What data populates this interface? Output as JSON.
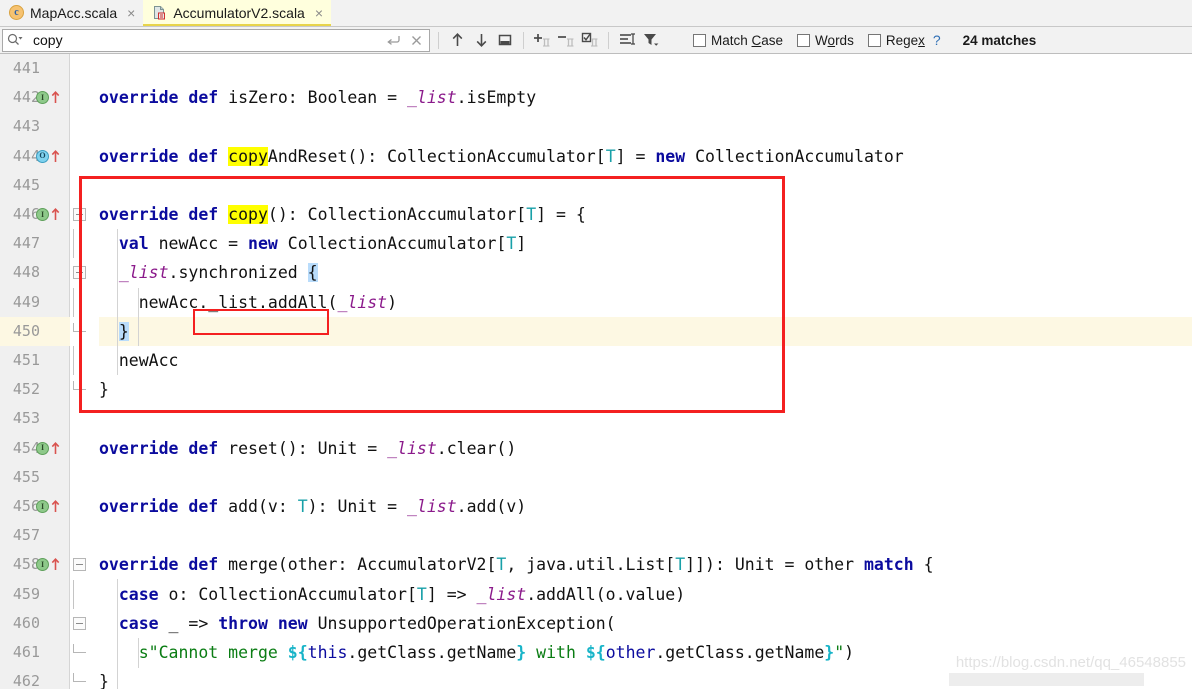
{
  "tabs": [
    {
      "label": "MapAcc.scala",
      "icon": "scala-class-icon",
      "close": "×",
      "active": false
    },
    {
      "label": "AccumulatorV2.scala",
      "icon": "scala-object-icon",
      "close": "×",
      "active": true
    }
  ],
  "find_toolbar": {
    "search_value": "copy",
    "search_placeholder": "Search",
    "history_icon": "search-dropdown-icon",
    "newline_icon": "multiline-toggle-icon",
    "clear_icon": "clear-search-icon",
    "prev_icon": "find-previous-icon",
    "next_icon": "find-next-icon",
    "open_panel_icon": "open-in-find-window-icon",
    "add_selection_icon": "add-selection-icon",
    "remove_selection_icon": "remove-selection-icon",
    "select_all_icon": "select-all-occurrences-icon",
    "in_selection_icon": "find-in-selection-icon",
    "filter_icon": "filter-icon",
    "match_case_label": "Match Case",
    "match_case_mnemonic": "C",
    "words_label": "Words",
    "words_mnemonic": "o",
    "regex_label": "Regex",
    "regex_mnemonic": "x",
    "help_label": "?",
    "match_count": "24 matches"
  },
  "editor": {
    "current_line": 450,
    "first_line": 441,
    "lines": [
      {
        "num": 441,
        "gutter": [],
        "fold": "",
        "code": ""
      },
      {
        "num": 442,
        "gutter": [
          "implements-icon",
          "override-arrow-icon"
        ],
        "fold": "",
        "code": "  override def isZero: Boolean = _list.isEmpty"
      },
      {
        "num": 443,
        "gutter": [],
        "fold": "",
        "code": ""
      },
      {
        "num": 444,
        "gutter": [
          "override-icon",
          "override-arrow-icon"
        ],
        "fold": "",
        "code": "  override def copyAndReset(): CollectionAccumulator[T] = new CollectionAccumulator"
      },
      {
        "num": 445,
        "gutter": [],
        "fold": "",
        "code": ""
      },
      {
        "num": 446,
        "gutter": [
          "implements-icon",
          "override-arrow-icon"
        ],
        "fold": "start",
        "code": "  override def copy(): CollectionAccumulator[T] = {"
      },
      {
        "num": 447,
        "gutter": [],
        "fold": "",
        "code": "    val newAcc = new CollectionAccumulator[T]"
      },
      {
        "num": 448,
        "gutter": [],
        "fold": "start",
        "code": "    _list.synchronized {"
      },
      {
        "num": 449,
        "gutter": [],
        "fold": "",
        "code": "      newAcc._list.addAll(_list)"
      },
      {
        "num": 450,
        "gutter": [],
        "fold": "end",
        "code": "    }"
      },
      {
        "num": 451,
        "gutter": [],
        "fold": "",
        "code": "    newAcc"
      },
      {
        "num": 452,
        "gutter": [],
        "fold": "end",
        "code": "  }"
      },
      {
        "num": 453,
        "gutter": [],
        "fold": "",
        "code": ""
      },
      {
        "num": 454,
        "gutter": [
          "implements-icon",
          "override-arrow-icon"
        ],
        "fold": "",
        "code": "  override def reset(): Unit = _list.clear()"
      },
      {
        "num": 455,
        "gutter": [],
        "fold": "",
        "code": ""
      },
      {
        "num": 456,
        "gutter": [
          "implements-icon",
          "override-arrow-icon"
        ],
        "fold": "",
        "code": "  override def add(v: T): Unit = _list.add(v)"
      },
      {
        "num": 457,
        "gutter": [],
        "fold": "",
        "code": ""
      },
      {
        "num": 458,
        "gutter": [
          "implements-icon",
          "override-arrow-icon"
        ],
        "fold": "start",
        "code": "  override def merge(other: AccumulatorV2[T, java.util.List[T]]): Unit = other match {"
      },
      {
        "num": 459,
        "gutter": [],
        "fold": "",
        "code": "    case o: CollectionAccumulator[T] => _list.addAll(o.value)"
      },
      {
        "num": 460,
        "gutter": [],
        "fold": "start",
        "code": "    case _ => throw new UnsupportedOperationException("
      },
      {
        "num": 461,
        "gutter": [],
        "fold": "end",
        "code": "      s\"Cannot merge ${this.getClass.getName} with ${other.getClass.getName}\")"
      },
      {
        "num": 462,
        "gutter": [],
        "fold": "end",
        "code": "  }"
      }
    ],
    "search_highlight_term": "copy",
    "annotation_boxes": [
      {
        "name": "copy-method-annotation-box",
        "color": "#f42020"
      },
      {
        "name": "synchronized-annotation-box",
        "color": "#f42020"
      }
    ]
  },
  "watermark": {
    "text": "https://blog.csdn.net/qq_46548855"
  },
  "colors": {
    "keyword": "#0b0b9e",
    "field": "#8b1a8b",
    "type": "#18a0a8",
    "string": "#0b7d14",
    "interpolation": "#18b4c8",
    "search_highlight": "#ffff00",
    "selection": "#b9dcfb",
    "current_line": "#fdf8e3",
    "annotation_red": "#f42020",
    "active_tab_bg": "#ffffdd"
  }
}
